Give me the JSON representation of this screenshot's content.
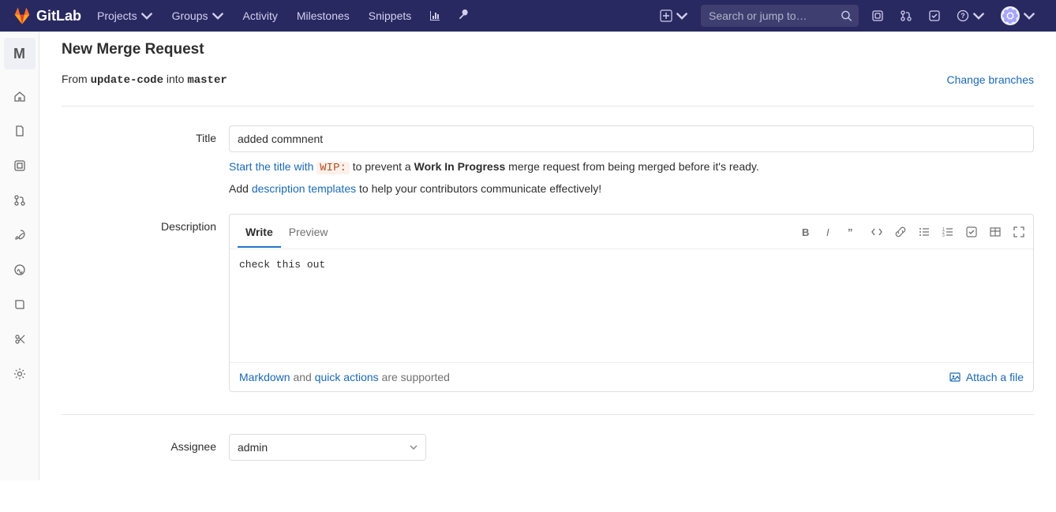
{
  "brand": "GitLab",
  "navbar": {
    "projects": "Projects",
    "groups": "Groups",
    "activity": "Activity",
    "milestones": "Milestones",
    "snippets": "Snippets"
  },
  "search": {
    "placeholder": "Search or jump to…"
  },
  "project_avatar_letter": "M",
  "page": {
    "title": "New Merge Request",
    "from_prefix": "From ",
    "source_branch": "update-code",
    "into_word": " into ",
    "target_branch": "master",
    "change_branches": "Change branches"
  },
  "title_section": {
    "label": "Title",
    "value": "added commnent",
    "help1_pre": "Start the title with ",
    "help1_chip": "WIP:",
    "help1_mid": " to prevent a ",
    "help1_strong": "Work In Progress",
    "help1_post": " merge request from being merged before it's ready.",
    "help2_pre": "Add ",
    "help2_link": "description templates",
    "help2_post": " to help your contributors communicate effectively!"
  },
  "description_section": {
    "label": "Description",
    "tab_write": "Write",
    "tab_preview": "Preview",
    "value": "check this out",
    "footer_markdown": "Markdown",
    "footer_and": " and ",
    "footer_quick": "quick actions",
    "footer_tail": " are supported",
    "attach": "Attach a file"
  },
  "assignee_section": {
    "label": "Assignee",
    "value": "admin"
  }
}
